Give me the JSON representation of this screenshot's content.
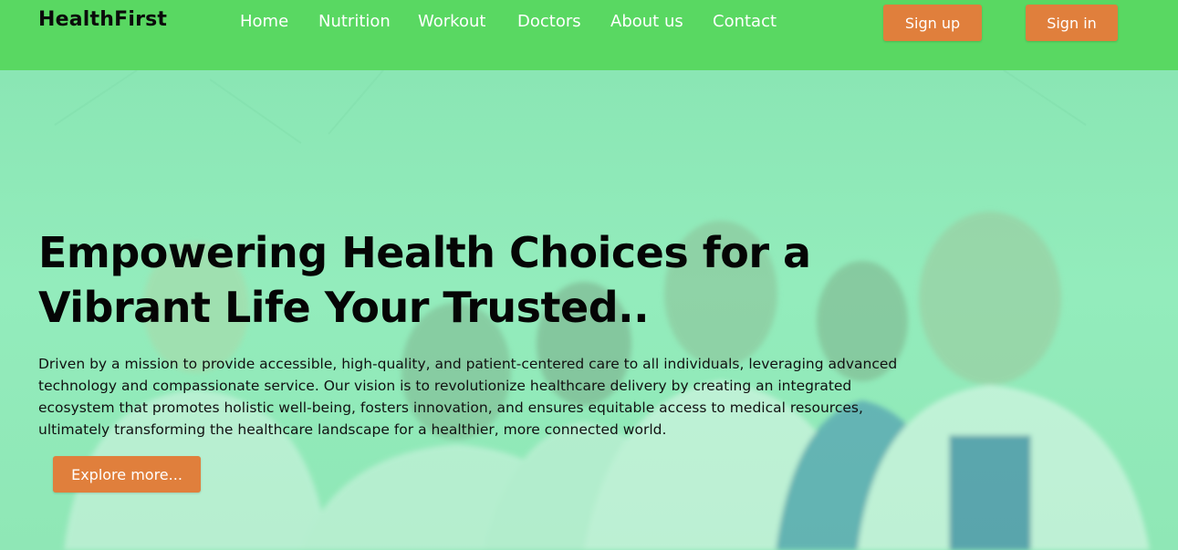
{
  "header": {
    "brand": "HealthFirst",
    "nav": [
      {
        "label": "Home"
      },
      {
        "label": "Nutrition"
      },
      {
        "label": "Workout"
      },
      {
        "label": "Doctors"
      },
      {
        "label": "About us"
      },
      {
        "label": "Contact"
      }
    ],
    "signup_label": "Sign up",
    "signin_label": "Sign in"
  },
  "hero": {
    "title_line1": "Empowering Health Choices for a",
    "title_line2": "Vibrant Life Your Trusted..",
    "description": "Driven by a mission to provide accessible, high-quality, and patient-centered care to all individuals, leveraging advanced technology and compassionate service. Our vision is to revolutionize healthcare delivery by creating an integrated ecosystem that promotes holistic well-being, fosters innovation, and ensures equitable access to medical resources, ultimately transforming the healthcare landscape for a healthier, more connected world.",
    "cta_label": "Explore more..."
  },
  "colors": {
    "navbar": "#59d862",
    "accent": "#e07f3c",
    "hero_overlay": "#8ee8b6"
  }
}
